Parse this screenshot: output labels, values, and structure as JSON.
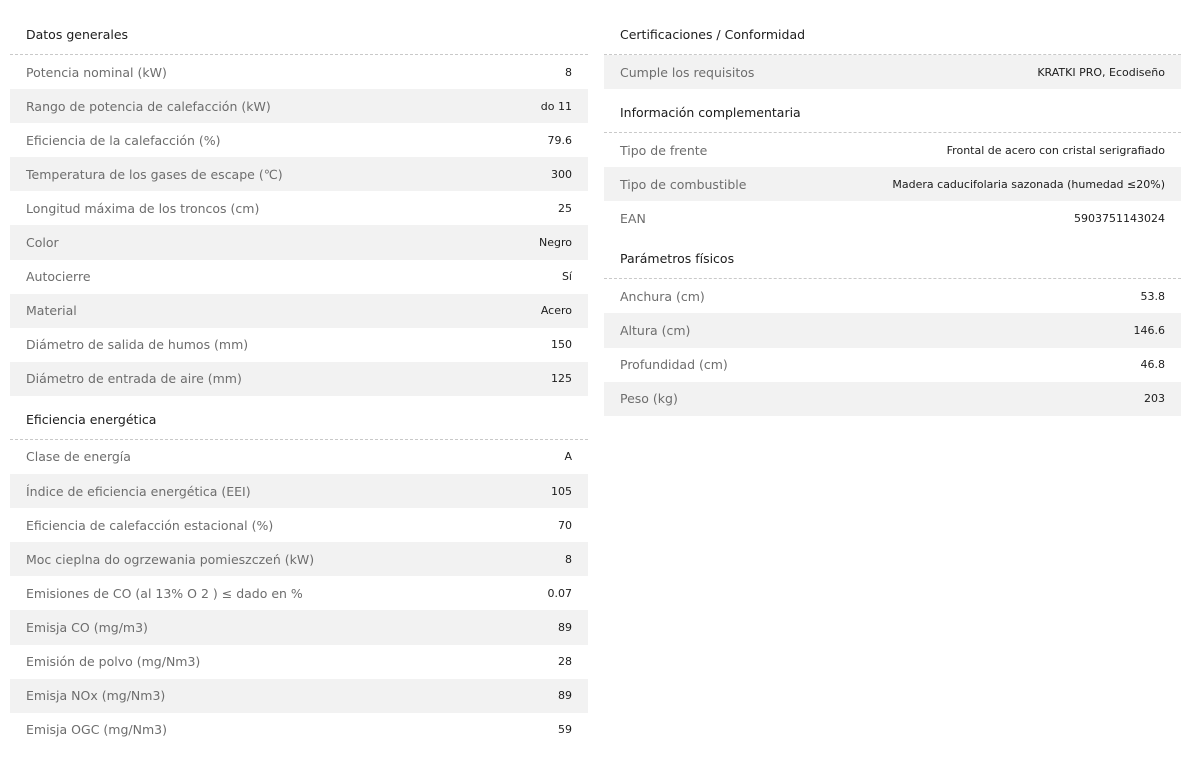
{
  "left": {
    "sections": [
      {
        "title": "Datos generales",
        "rows": [
          {
            "label": "Potencia nominal (kW)",
            "value": "8"
          },
          {
            "label": "Rango de potencia de calefacción (kW)",
            "value": "do 11"
          },
          {
            "label": "Eficiencia de la calefacción (%)",
            "value": "79.6"
          },
          {
            "label": "Temperatura de los gases de escape (℃)",
            "value": "300"
          },
          {
            "label": "Longitud máxima de los troncos (cm)",
            "value": "25"
          },
          {
            "label": "Color",
            "value": "Negro"
          },
          {
            "label": "Autocierre",
            "value": "Sí"
          },
          {
            "label": "Material",
            "value": "Acero"
          },
          {
            "label": "Diámetro de salida de humos (mm)",
            "value": "150"
          },
          {
            "label": "Diámetro de entrada de aire (mm)",
            "value": "125"
          }
        ]
      },
      {
        "title": "Eficiencia energética",
        "rows": [
          {
            "label": "Clase de energía",
            "value": "A"
          },
          {
            "label": "Índice de eficiencia energética (EEI)",
            "value": "105"
          },
          {
            "label": "Eficiencia de calefacción estacional (%)",
            "value": "70"
          },
          {
            "label": "Moc cieplna do ogrzewania pomieszczeń (kW)",
            "value": "8"
          },
          {
            "label": "Emisiones de CO (al 13% O 2 ) ≤ dado en %",
            "value": "0.07"
          },
          {
            "label": "Emisja CO (mg/m3)",
            "value": "89"
          },
          {
            "label": "Emisión de polvo (mg/Nm3)",
            "value": "28"
          },
          {
            "label": "Emisja NOx (mg/Nm3)",
            "value": "89"
          },
          {
            "label": "Emisja OGC (mg/Nm3)",
            "value": "59"
          }
        ]
      }
    ]
  },
  "right": {
    "sections": [
      {
        "title": "Certificaciones / Conformidad",
        "rows": [
          {
            "label": "Cumple los requisitos",
            "value": "KRATKI PRO, Ecodiseño"
          }
        ]
      },
      {
        "title": "Información complementaria",
        "rows": [
          {
            "label": "Tipo de frente",
            "value": "Frontal de acero con cristal serigrafiado"
          },
          {
            "label": "Tipo de combustible",
            "value": "Madera caducifolaria sazonada (humedad ≤20%)"
          },
          {
            "label": "EAN",
            "value": "5903751143024"
          }
        ]
      },
      {
        "title": "Parámetros físicos",
        "rows": [
          {
            "label": "Anchura (cm)",
            "value": "53.8"
          },
          {
            "label": "Altura (cm)",
            "value": "146.6"
          },
          {
            "label": "Profundidad (cm)",
            "value": "46.8"
          },
          {
            "label": "Peso (kg)",
            "value": "203"
          }
        ]
      }
    ]
  }
}
